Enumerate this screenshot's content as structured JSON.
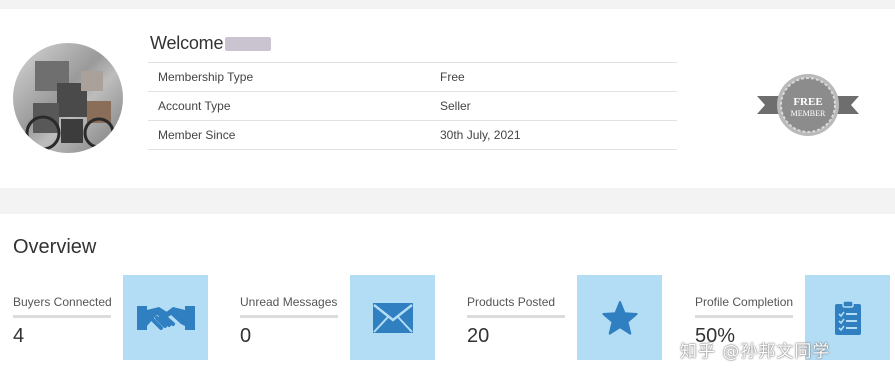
{
  "profile": {
    "welcome_label": "Welcome",
    "rows": [
      {
        "label": "Membership Type",
        "value": "Free"
      },
      {
        "label": "Account Type",
        "value": "Seller"
      },
      {
        "label": "Member Since",
        "value": "30th July, 2021"
      }
    ],
    "badge_line1": "FREE",
    "badge_line2": "MEMBER"
  },
  "overview": {
    "title": "Overview",
    "stats": [
      {
        "label": "Buyers Connected",
        "value": "4",
        "icon": "handshake-icon"
      },
      {
        "label": "Unread Messages",
        "value": "0",
        "icon": "envelope-icon"
      },
      {
        "label": "Products Posted",
        "value": "20",
        "icon": "star-icon"
      },
      {
        "label": "Profile Completion",
        "value": "50%",
        "icon": "clipboard-icon"
      }
    ]
  },
  "watermark": "知乎 @孙邦文同学",
  "colors": {
    "tile_bg": "#b3dcf5",
    "icon_blue": "#2f7fc1",
    "page_bg": "#f3f3f3",
    "badge_grey": "#8c8c8c"
  }
}
